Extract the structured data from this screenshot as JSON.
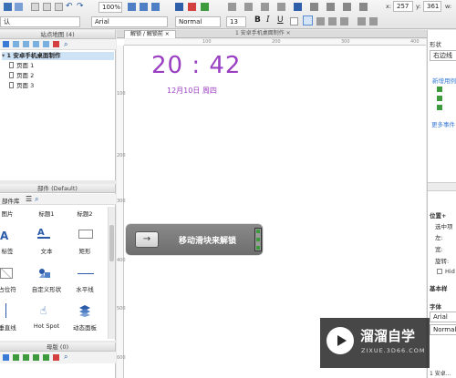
{
  "toolbar": {
    "zoom": "100%",
    "font_family": "Arial",
    "font_style": "Normal",
    "font_size": "13",
    "left_dropdown": "认",
    "x_label": "x:",
    "x_value": "257",
    "y_label": "y:",
    "y_value": "361",
    "w_label": "w:"
  },
  "sitemap": {
    "title": "站点地图 (4)",
    "root": "1 安卓手机桌面制作",
    "pages": [
      "页面 1",
      "页面 2",
      "页面 3"
    ]
  },
  "tabs": [
    "解锁 / 解锁前",
    "1 安卓手机桌面制作"
  ],
  "canvas": {
    "time": "20 : 42",
    "date": "12月10日  周四",
    "slider_label": "移动滑块来解锁",
    "slider_arrow": "→",
    "ruler_top": [
      "100",
      "200",
      "300",
      "400"
    ],
    "ruler_left": [
      "100",
      "200",
      "300",
      "400",
      "500",
      "600"
    ]
  },
  "widgets": {
    "title": "部件 (Default)",
    "library_label": "部件库",
    "items": [
      {
        "label": "图片"
      },
      {
        "label": "标题1"
      },
      {
        "label": "标题2"
      },
      {
        "label": "标签"
      },
      {
        "label": "文本"
      },
      {
        "label": "矩形"
      },
      {
        "label": "占位符"
      },
      {
        "label": "自定义形状"
      },
      {
        "label": "水平线"
      },
      {
        "label": "垂直线"
      },
      {
        "label": "Hot Spot"
      },
      {
        "label": "动态面板"
      }
    ]
  },
  "masters": {
    "title": "母版 (0)"
  },
  "right_panel": {
    "title": "形状",
    "dropdown": "右边线",
    "interactions_title": "新增用例",
    "more_events": "更多事件",
    "position_title": "位置+",
    "select_label": "选中项",
    "left_label": "左:",
    "width_label": "宽:",
    "rotate_label": "旋转:",
    "hidden_label": "Hid",
    "basic_style": "基本样",
    "font_section": "字体",
    "font_value": "Arial",
    "font_style": "Normal",
    "bottom_tab": "1 安卓..."
  },
  "watermark": {
    "title": "溜溜自学",
    "url": "ZIXUE.3D66.COM"
  }
}
